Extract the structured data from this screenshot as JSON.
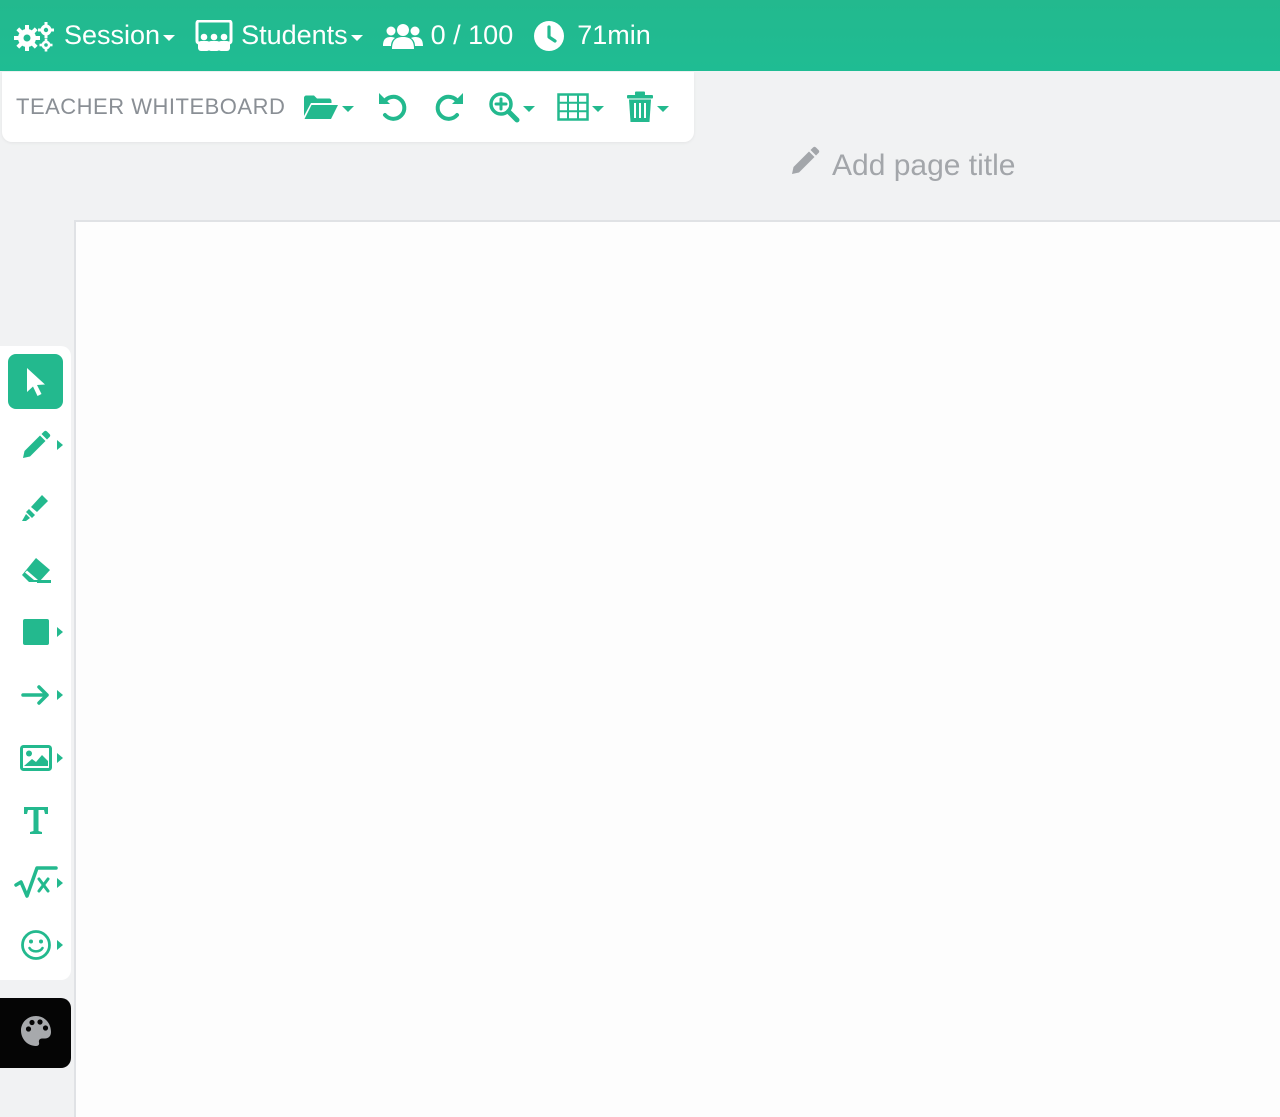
{
  "topbar": {
    "session_label": "Session",
    "students_label": "Students",
    "participants_count": "0 / 100",
    "timer": "71min"
  },
  "whiteboard_toolbar": {
    "title": "TEACHER WHITEBOARD"
  },
  "page_title": {
    "placeholder": "Add page title"
  },
  "tools": [
    {
      "name": "select",
      "icon": "cursor-arrow-icon",
      "active": true
    },
    {
      "name": "pen",
      "icon": "pencil-icon"
    },
    {
      "name": "highlighter",
      "icon": "highlighter-icon"
    },
    {
      "name": "eraser",
      "icon": "eraser-icon"
    },
    {
      "name": "shape",
      "icon": "square-icon"
    },
    {
      "name": "arrow",
      "icon": "arrow-right-icon"
    },
    {
      "name": "image",
      "icon": "image-icon"
    },
    {
      "name": "text",
      "icon": "text-t-icon"
    },
    {
      "name": "math",
      "icon": "square-root-icon"
    },
    {
      "name": "emoji",
      "icon": "smiley-icon"
    }
  ],
  "colors": {
    "accent": "#23b98e",
    "palette_button": "#050505",
    "muted_text": "#8a8f95"
  }
}
